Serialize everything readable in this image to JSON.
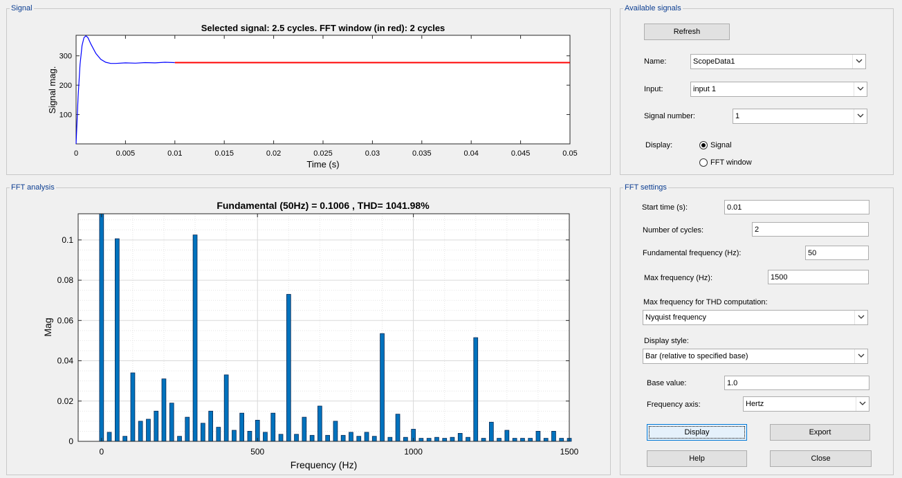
{
  "signal_panel": {
    "title": "Signal",
    "chart_title": "Selected signal: 2.5 cycles. FFT window (in red): 2 cycles",
    "xlabel": "Time (s)",
    "ylabel": "Signal mag.",
    "xticks": [
      "0",
      "0.005",
      "0.01",
      "0.015",
      "0.02",
      "0.025",
      "0.03",
      "0.035",
      "0.04",
      "0.045",
      "0.05"
    ],
    "yticks": [
      "100",
      "200",
      "300"
    ]
  },
  "fft_panel": {
    "title": "FFT analysis",
    "chart_title": "Fundamental (50Hz) = 0.1006 , THD= 1041.98%",
    "xlabel": "Frequency (Hz)",
    "ylabel": "Mag",
    "xticks": [
      "0",
      "500",
      "1000",
      "1500"
    ],
    "yticks": [
      "0",
      "0.02",
      "0.04",
      "0.06",
      "0.08",
      "0.1"
    ]
  },
  "chart_data": [
    {
      "type": "line",
      "title": "Selected signal: 2.5 cycles. FFT window (in red): 2 cycles",
      "xlabel": "Time (s)",
      "ylabel": "Signal mag.",
      "xlim": [
        0,
        0.05
      ],
      "ylim": [
        0,
        370
      ],
      "grid": false,
      "series": [
        {
          "color": "#0000ff",
          "x": [
            0,
            0.0002,
            0.0004,
            0.0006,
            0.0008,
            0.001,
            0.0012,
            0.0015,
            0.002,
            0.0025,
            0.003,
            0.0035,
            0.004,
            0.005,
            0.006,
            0.007,
            0.008,
            0.009,
            0.01
          ],
          "y": [
            0,
            160,
            270,
            335,
            362,
            368,
            362,
            340,
            308,
            288,
            278,
            274,
            274,
            276,
            275,
            277,
            276,
            278,
            277
          ]
        },
        {
          "color": "#ff0000",
          "x": [
            0.01,
            0.05
          ],
          "y": [
            277,
            277
          ]
        }
      ]
    },
    {
      "type": "bar",
      "title": "Fundamental (50Hz) = 0.1006 , THD= 1041.98%",
      "xlabel": "Frequency (Hz)",
      "ylabel": "Mag",
      "xlim": [
        -75,
        1500
      ],
      "ylim": [
        0,
        0.113
      ],
      "grid": true,
      "color": "#0072bd",
      "x": [
        0,
        25,
        50,
        75,
        100,
        125,
        150,
        175,
        200,
        225,
        250,
        275,
        300,
        325,
        350,
        375,
        400,
        425,
        450,
        475,
        500,
        525,
        550,
        575,
        600,
        625,
        650,
        675,
        700,
        725,
        750,
        775,
        800,
        825,
        850,
        875,
        900,
        925,
        950,
        975,
        1000,
        1025,
        1050,
        1075,
        1100,
        1125,
        1150,
        1175,
        1200,
        1225,
        1250,
        1275,
        1300,
        1325,
        1350,
        1375,
        1400,
        1425,
        1450,
        1475,
        1500
      ],
      "values": [
        0.113,
        0.0045,
        0.1006,
        0.0025,
        0.034,
        0.01,
        0.011,
        0.015,
        0.031,
        0.019,
        0.0025,
        0.012,
        0.1025,
        0.009,
        0.015,
        0.007,
        0.033,
        0.0055,
        0.014,
        0.005,
        0.0105,
        0.0045,
        0.014,
        0.0035,
        0.073,
        0.0035,
        0.012,
        0.003,
        0.0175,
        0.003,
        0.01,
        0.003,
        0.0045,
        0.0025,
        0.0045,
        0.0025,
        0.0535,
        0.002,
        0.0135,
        0.002,
        0.006,
        0.0015,
        0.0015,
        0.002,
        0.0015,
        0.002,
        0.004,
        0.002,
        0.0515,
        0.0015,
        0.0095,
        0.0015,
        0.0055,
        0.0015,
        0.0015,
        0.0015,
        0.005,
        0.0015,
        0.005,
        0.0015,
        0.0015
      ]
    }
  ],
  "available_signals": {
    "title": "Available signals",
    "refresh_label": "Refresh",
    "name_label": "Name:",
    "name_value": "ScopeData1",
    "input_label": "Input:",
    "input_value": "input 1",
    "signal_number_label": "Signal number:",
    "signal_number_value": "1",
    "display_label": "Display:",
    "display_options": [
      "Signal",
      "FFT window"
    ],
    "display_selected": "Signal"
  },
  "fft_settings": {
    "title": "FFT settings",
    "start_time_label": "Start time (s):",
    "start_time_value": "0.01",
    "cycles_label": "Number of cycles:",
    "cycles_value": "2",
    "fund_freq_label": "Fundamental frequency (Hz):",
    "fund_freq_value": "50",
    "max_freq_label": "Max frequency (Hz):",
    "max_freq_value": "1500",
    "thd_label": "Max frequency for THD computation:",
    "thd_value": "Nyquist frequency",
    "display_style_label": "Display style:",
    "display_style_value": "Bar (relative to specified base)",
    "base_label": "Base value:",
    "base_value": "1.0",
    "freq_axis_label": "Frequency axis:",
    "freq_axis_value": "Hertz",
    "buttons": {
      "display": "Display",
      "export": "Export",
      "help": "Help",
      "close": "Close"
    }
  },
  "icons": {
    "dropdown": "chevron-down-icon"
  },
  "colors": {
    "panel_title": "#0b3d91",
    "signal_line": "#0000ff",
    "fft_window": "#ff0000",
    "bars": "#0072bd"
  }
}
